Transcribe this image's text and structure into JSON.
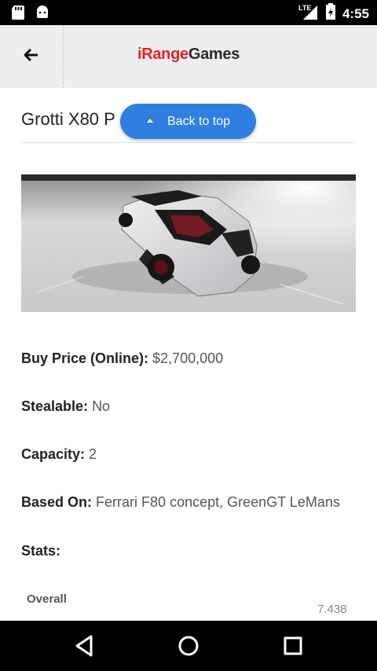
{
  "status_bar": {
    "time": "4:55",
    "network": "LTE",
    "icons": [
      "sd-card-icon",
      "android-icon",
      "signal-icon",
      "battery-icon"
    ]
  },
  "header": {
    "brand_red": "iRange",
    "brand_dark": "Games",
    "back_icon": "arrow-left-icon"
  },
  "article": {
    "title": "Grotti X80 P",
    "back_to_top": "Back to top",
    "image_alt": "Grotti X80 Proto car in garage",
    "details": [
      {
        "label": "Buy Price (Online):",
        "value": "$2,700,000"
      },
      {
        "label": "Stealable:",
        "value": "No"
      },
      {
        "label": "Capacity:",
        "value": "2"
      },
      {
        "label": "Based On:",
        "value": "Ferrari F80 concept, GreenGT LeMans"
      }
    ],
    "stats_title": "Stats:",
    "overall_label": "Overall",
    "overall_value": "7.438"
  },
  "nav": {
    "icons": [
      "back-triangle-icon",
      "home-circle-icon",
      "recents-square-icon"
    ]
  },
  "colors": {
    "accent": "#2f7fe0",
    "brand_red": "#e8222a"
  }
}
